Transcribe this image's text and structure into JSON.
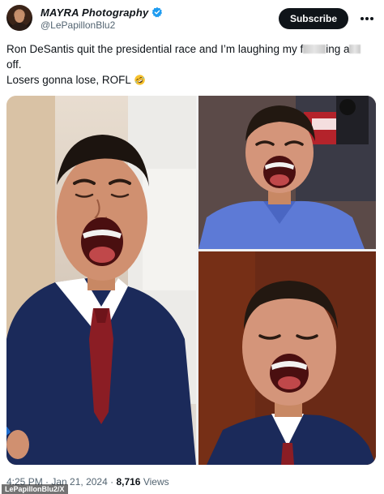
{
  "author": {
    "display_name": "MAYRA Photography",
    "handle": "@LePapillonBlu2",
    "verified": true
  },
  "actions": {
    "subscribe_label": "Subscribe",
    "more_icon": "more-horizontal-icon"
  },
  "tweet": {
    "line1_start": "Ron DeSantis quit the presidential race and I’m laughing my f",
    "line1_end": "ing a",
    "line1_tail": "off.",
    "line2": "Losers gonna lose, ROFL",
    "emoji": "rolling-on-floor-laughing-emoji"
  },
  "meta": {
    "time": "4:25 PM",
    "date": "Jan 21, 2024",
    "views_count": "8,716",
    "views_label": "Views"
  },
  "watermark": "LePapillonBlu2/X",
  "colors": {
    "text": "#0f1419",
    "secondary": "#536471",
    "verified_blue": "#1d9bf0",
    "suit_navy": "#1b2a5a",
    "tie_red": "#8b1d24"
  }
}
